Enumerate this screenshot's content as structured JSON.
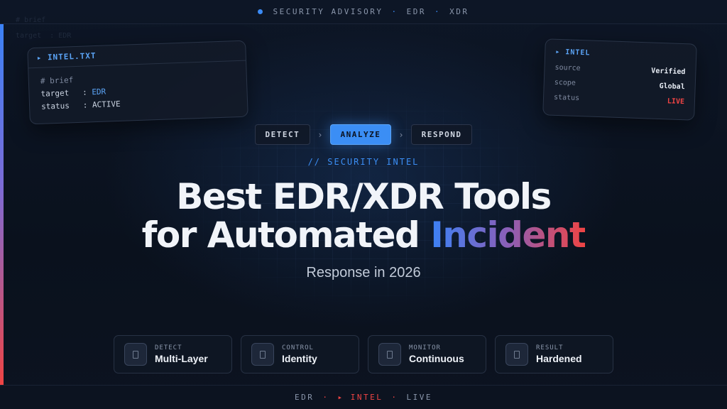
{
  "colors": {
    "accent": "#3b8ef5",
    "alert": "#ef4444",
    "background": "#0b1220"
  },
  "topbar": {
    "items": [
      "SECURITY ADVISORY",
      "EDR",
      "XDR"
    ]
  },
  "ghost_text": {
    "lines": [
      "# brief",
      "target  : EDR"
    ]
  },
  "card_left": {
    "title": "▸ INTEL.TXT",
    "comment": "# brief",
    "rows": [
      {
        "key": "target",
        "value": "EDR"
      },
      {
        "key": "status",
        "value": "ACTIVE"
      }
    ]
  },
  "card_right": {
    "title": "▸ INTEL",
    "rows": [
      {
        "key": "source",
        "value": "Verified"
      },
      {
        "key": "scope",
        "value": "Global"
      },
      {
        "key": "status",
        "value": "LIVE"
      }
    ]
  },
  "steps": [
    "DETECT",
    "ANALYZE",
    "RESPOND"
  ],
  "active_step": "ANALYZE",
  "kicker": "// SECURITY INTEL",
  "headline": {
    "line1": "Best EDR/XDR Tools",
    "line2_plain": "for Automated ",
    "line2_highlight": "Incident"
  },
  "subheadline": "Response in 2026",
  "features": [
    {
      "label": "DETECT",
      "value": "Multi-Layer",
      "icon": "phone-icon"
    },
    {
      "label": "CONTROL",
      "value": "Identity",
      "icon": "phone-icon"
    },
    {
      "label": "MONITOR",
      "value": "Continuous",
      "icon": "phone-icon"
    },
    {
      "label": "RESULT",
      "value": "Hardened",
      "icon": "phone-icon"
    }
  ],
  "bottombar": {
    "items": [
      "EDR",
      "▸ INTEL",
      "LIVE"
    ]
  }
}
